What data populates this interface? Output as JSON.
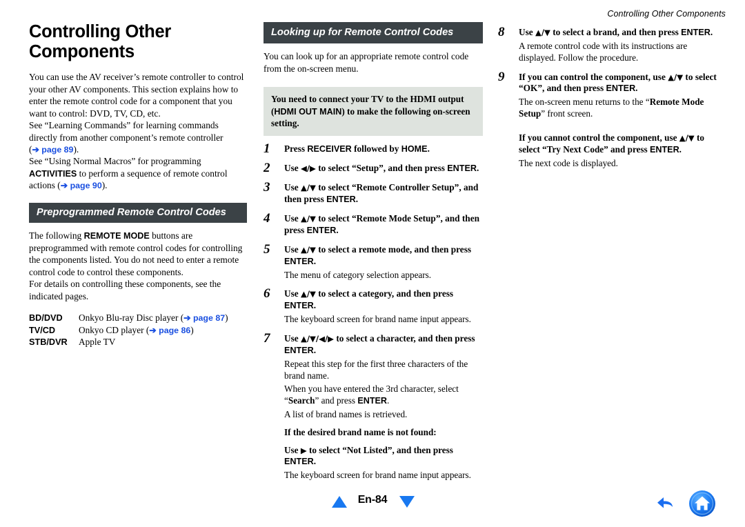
{
  "running_header": "Controlling Other Components",
  "colors": {
    "section_bar_bg": "#3b4246",
    "note_bg": "#dee3de",
    "link_blue": "#1a4fe0",
    "nav_blue": "#1878f0"
  },
  "left_column": {
    "title": "Controlling Other Components",
    "intro_p1_a": "You can use the AV receiver’s remote controller to control your other AV components. This section explains how to enter the remote control code for a component that you want to control: DVD, TV, CD, etc.",
    "intro_p2_a": "See “Learning Commands” for learning commands directly from another component’s remote controller (",
    "intro_p2_link": "➔ page 89",
    "intro_p2_b": ").",
    "intro_p3_a": "See “Using Normal Macros” for programming ",
    "intro_p3_bold": "ACTIVITIES",
    "intro_p3_b": " to perform a sequence of remote control actions (",
    "intro_p3_link": "➔ page 90",
    "intro_p3_c": ").",
    "section_title": "Preprogrammed Remote Control Codes",
    "sec_p1_a": "The following ",
    "sec_p1_bold": "REMOTE MODE",
    "sec_p1_b": " buttons are preprogrammed with remote control codes for controlling the components listed. You do not need to enter a remote control code to control these components.",
    "sec_p2": "For details on controlling these components, see the indicated pages.",
    "components": [
      {
        "key": "BD/DVD",
        "value_a": "Onkyo Blu-ray Disc player (",
        "link": "➔ page 87",
        "value_b": ")"
      },
      {
        "key": "TV/CD",
        "value_a": "Onkyo CD player (",
        "link": "➔ page 86",
        "value_b": ")"
      },
      {
        "key": "STB/DVR",
        "value_a": "Apple TV",
        "link": "",
        "value_b": ""
      }
    ]
  },
  "middle_column": {
    "section_title": "Looking up for Remote Control Codes",
    "intro": "You can look up for an appropriate remote control code from the on-screen menu.",
    "note_a": "You need to connect your TV to the HDMI output (",
    "note_bold": "HDMI OUT MAIN",
    "note_b": ") to make the following on-screen setting.",
    "steps": [
      {
        "num": "1",
        "parts": [
          {
            "t": "Press ",
            "s": "serif-bold"
          },
          {
            "t": "RECEIVER",
            "s": "sans-bold"
          },
          {
            "t": " followed by ",
            "s": "serif-bold"
          },
          {
            "t": "HOME",
            "s": "sans-bold"
          },
          {
            "t": ".",
            "s": "serif-bold"
          }
        ],
        "subs": []
      },
      {
        "num": "2",
        "parts": [
          {
            "t": "Use ",
            "s": "serif-bold"
          },
          {
            "t": "◀/▶",
            "s": "arrow"
          },
          {
            "t": " to select “Setup”, and then press ",
            "s": "serif-bold"
          },
          {
            "t": "ENTER",
            "s": "sans-bold"
          },
          {
            "t": ".",
            "s": "serif-bold"
          }
        ],
        "subs": []
      },
      {
        "num": "3",
        "parts": [
          {
            "t": "Use ",
            "s": "serif-bold"
          },
          {
            "t": "▲/▼",
            "s": "arrow"
          },
          {
            "t": " to select “Remote Controller Setup”, and then press ",
            "s": "serif-bold"
          },
          {
            "t": "ENTER",
            "s": "sans-bold"
          },
          {
            "t": ".",
            "s": "serif-bold"
          }
        ],
        "subs": []
      },
      {
        "num": "4",
        "parts": [
          {
            "t": "Use ",
            "s": "serif-bold"
          },
          {
            "t": "▲/▼",
            "s": "arrow"
          },
          {
            "t": " to select “Remote Mode Setup”, and then press ",
            "s": "serif-bold"
          },
          {
            "t": "ENTER",
            "s": "sans-bold"
          },
          {
            "t": ".",
            "s": "serif-bold"
          }
        ],
        "subs": []
      },
      {
        "num": "5",
        "parts": [
          {
            "t": "Use ",
            "s": "serif-bold"
          },
          {
            "t": "▲/▼",
            "s": "arrow"
          },
          {
            "t": " to select a remote mode, and then press ",
            "s": "serif-bold"
          },
          {
            "t": "ENTER",
            "s": "sans-bold"
          },
          {
            "t": ".",
            "s": "serif-bold"
          }
        ],
        "subs": [
          {
            "text": "The menu of category selection appears.",
            "bold": false
          }
        ]
      },
      {
        "num": "6",
        "parts": [
          {
            "t": "Use ",
            "s": "serif-bold"
          },
          {
            "t": "▲/▼",
            "s": "arrow"
          },
          {
            "t": " to select a category, and then press ",
            "s": "serif-bold"
          },
          {
            "t": "ENTER",
            "s": "sans-bold"
          },
          {
            "t": ".",
            "s": "serif-bold"
          }
        ],
        "subs": [
          {
            "text": "The keyboard screen for brand name input appears.",
            "bold": false
          }
        ]
      },
      {
        "num": "7",
        "parts": [
          {
            "t": "Use ",
            "s": "serif-bold"
          },
          {
            "t": "▲/▼/◀/▶",
            "s": "arrow"
          },
          {
            "t": " to select a character, and then press ",
            "s": "serif-bold"
          },
          {
            "t": "ENTER",
            "s": "sans-bold"
          },
          {
            "t": ".",
            "s": "serif-bold"
          }
        ],
        "subs": [
          {
            "text": "Repeat this step for the first three characters of the brand name.",
            "bold": false
          }
        ]
      }
    ],
    "step7_extra": {
      "line1_a": "When you have entered the 3rd character, select “",
      "line1_bold": "Search",
      "line1_b": "” and press ",
      "line1_enter": "ENTER",
      "line1_c": ".",
      "line2": "A list of brand names is retrieved.",
      "line3": "If the desired brand name is not found:",
      "line4_a": "Use ",
      "line4_arrow": "▶",
      "line4_b": " to select “Not Listed”, and then press ",
      "line4_enter": "ENTER",
      "line4_c": ".",
      "line5": "The keyboard screen for brand name input appears."
    }
  },
  "right_column": {
    "steps": [
      {
        "num": "8",
        "parts": [
          {
            "t": "Use ",
            "s": "serif-bold"
          },
          {
            "t": "▲/▼",
            "s": "arrow"
          },
          {
            "t": " to select a brand, and then press ",
            "s": "serif-bold"
          },
          {
            "t": "ENTER",
            "s": "sans-bold"
          },
          {
            "t": ".",
            "s": "serif-bold"
          }
        ],
        "subs": [
          {
            "text": "A remote control code with its instructions are displayed. Follow the procedure.",
            "bold": false
          }
        ]
      },
      {
        "num": "9",
        "parts": [
          {
            "t": "If you can control the component, use ",
            "s": "serif-bold"
          },
          {
            "t": "▲/▼",
            "s": "arrow"
          },
          {
            "t": " to select “OK”, and then press ",
            "s": "serif-bold"
          },
          {
            "t": "ENTER",
            "s": "sans-bold"
          },
          {
            "t": ".",
            "s": "serif-bold"
          }
        ],
        "subs": []
      }
    ],
    "step9_sub_a": "The on-screen menu returns to the “",
    "step9_sub_bold": "Remote Mode Setup",
    "step9_sub_b": "” front screen.",
    "cannot_a": "If you cannot control the component, use ",
    "cannot_arrow": "▲/▼",
    "cannot_b": " to select “Try Next Code” and press ",
    "cannot_enter": "ENTER",
    "cannot_c": ".",
    "cannot_sub": "The next code is displayed."
  },
  "footer": {
    "page_label": "En-84",
    "prev_icon": "triangle-up-icon",
    "next_icon": "triangle-down-icon",
    "back_icon": "back-arrow-icon",
    "home_icon": "home-icon"
  }
}
